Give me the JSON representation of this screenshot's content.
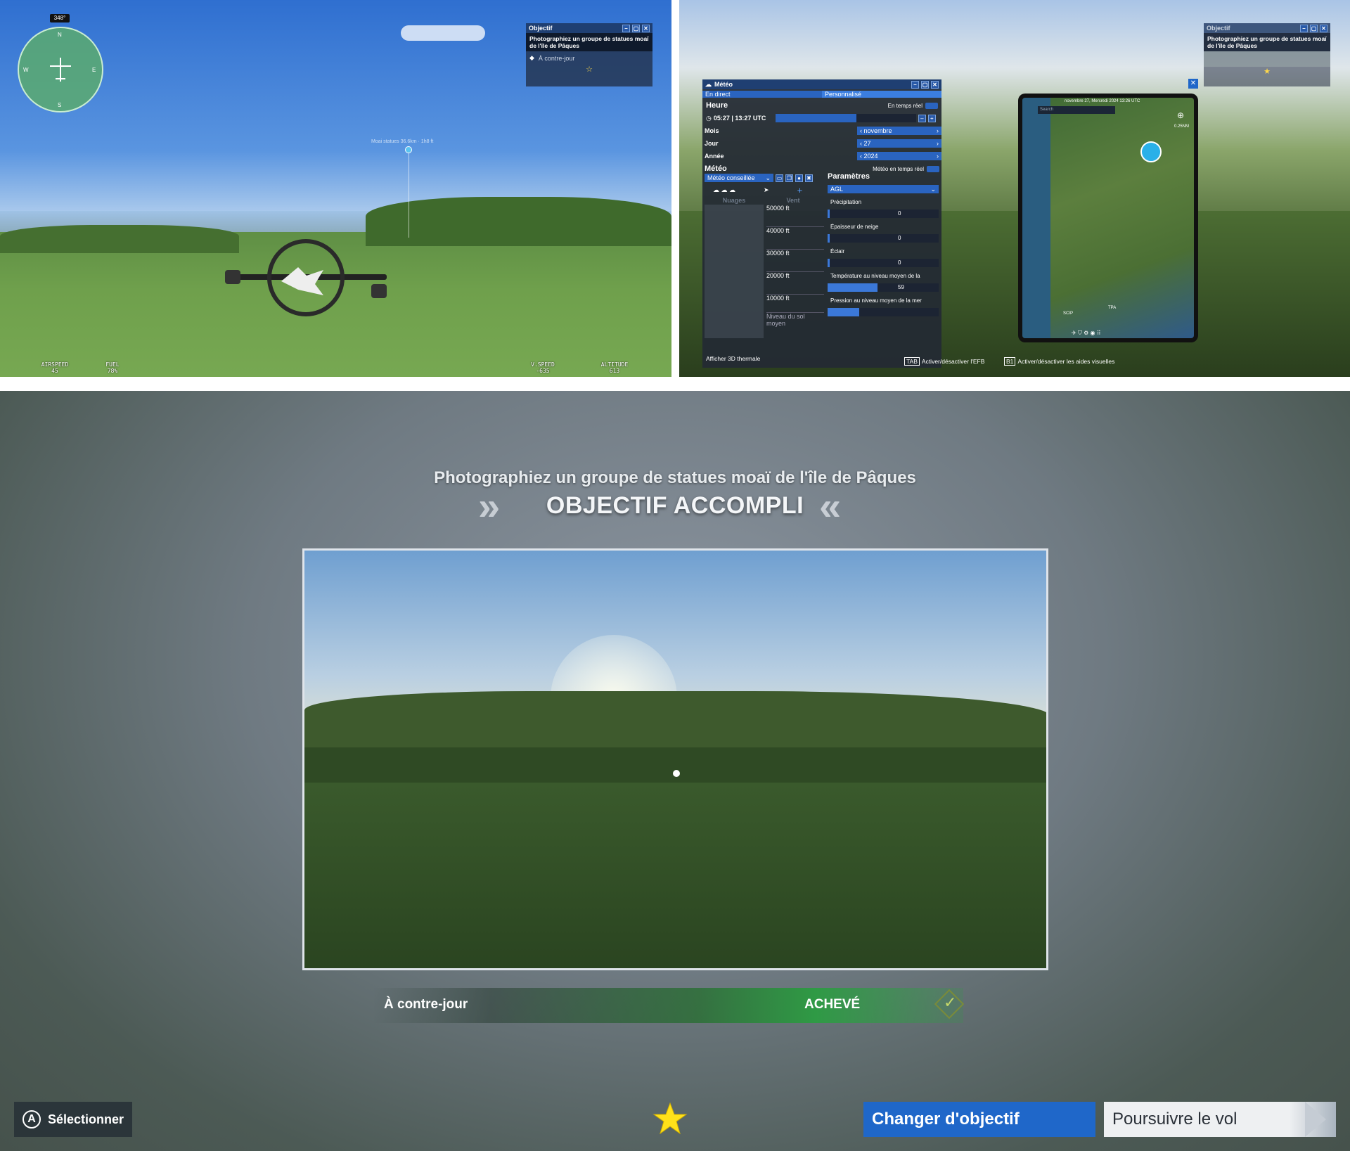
{
  "panel1": {
    "compass_heading": "348°",
    "objective_window": {
      "title": "Objectif",
      "description": "Photographiez un groupe de statues moaï de l'île de Pâques",
      "item": "À contre-jour"
    },
    "waypoint_label": "Moai statues 36.6km · 1h8 ft",
    "hud": [
      {
        "label": "AIRSPEED",
        "value": "45"
      },
      {
        "label": "FUEL",
        "value": "78%"
      },
      {
        "label": "V.SPEED",
        "value": "-635"
      },
      {
        "label": "ALTITUDE",
        "value": "613"
      }
    ]
  },
  "panel2": {
    "objective_window": {
      "title": "Objectif",
      "description": "Photographiez un groupe de statues moaï de l'île de Pâques"
    },
    "meteo": {
      "title": "Météo",
      "tab_live": "En direct",
      "tab_custom": "Personnalisé",
      "heure_title": "Heure",
      "realtime_label": "En temps réel",
      "time_value": "05:27 | 13:27 UTC",
      "mois_label": "Mois",
      "mois_value": "novembre",
      "jour_label": "Jour",
      "jour_value": "27",
      "annee_label": "Année",
      "annee_value": "2024",
      "meteo_title": "Météo",
      "meteo_realtime_label": "Météo en temps réel",
      "preset": "Météo conseillée",
      "clouds_header": "Nuages",
      "wind_header": "Vent",
      "altitudes": [
        "50000 ft",
        "40000 ft",
        "30000 ft",
        "20000 ft",
        "10000 ft",
        "Niveau du sol moyen"
      ],
      "params_title": "Paramètres",
      "agl": "AGL",
      "params": [
        {
          "label": "Précipitation",
          "value": "0",
          "fill": 0.02
        },
        {
          "label": "Épaisseur de neige",
          "value": "0",
          "fill": 0.02
        },
        {
          "label": "Éclair",
          "value": "0",
          "fill": 0.02
        },
        {
          "label": "Température au niveau moyen de la",
          "value": "59",
          "fill": 0.47
        },
        {
          "label": "Pression au niveau moyen de la mer",
          "value": "",
          "fill": 0.3
        }
      ],
      "thermal_label": "Afficher 3D thermale"
    },
    "efb": {
      "date": "novembre 27, Mercredi 2024 13:26 UTC",
      "search_placeholder": "Search",
      "scale": "0.25NM",
      "airport1": "SCIP",
      "airport2": "TPA"
    },
    "hint_tab_key": "TAB",
    "hint_tab": "Activer/désactiver l'EFB",
    "hint_b1_key": "B1",
    "hint_b1": "Activer/désactiver les aides visuelles"
  },
  "result": {
    "subtitle": "Photographiez un groupe de statues moaï de l'île de Pâques",
    "title": "OBJECTIF ACCOMPLI",
    "objective_item": "À contre-jour",
    "status": "ACHEVÉ",
    "select_key": "A",
    "select_label": "Sélectionner",
    "change_button": "Changer d'objectif",
    "continue_button": "Poursuivre le vol"
  },
  "colors": {
    "accent_blue": "#1f67c9",
    "success_green": "#2f9a45",
    "star_yellow": "#ffe11a"
  }
}
